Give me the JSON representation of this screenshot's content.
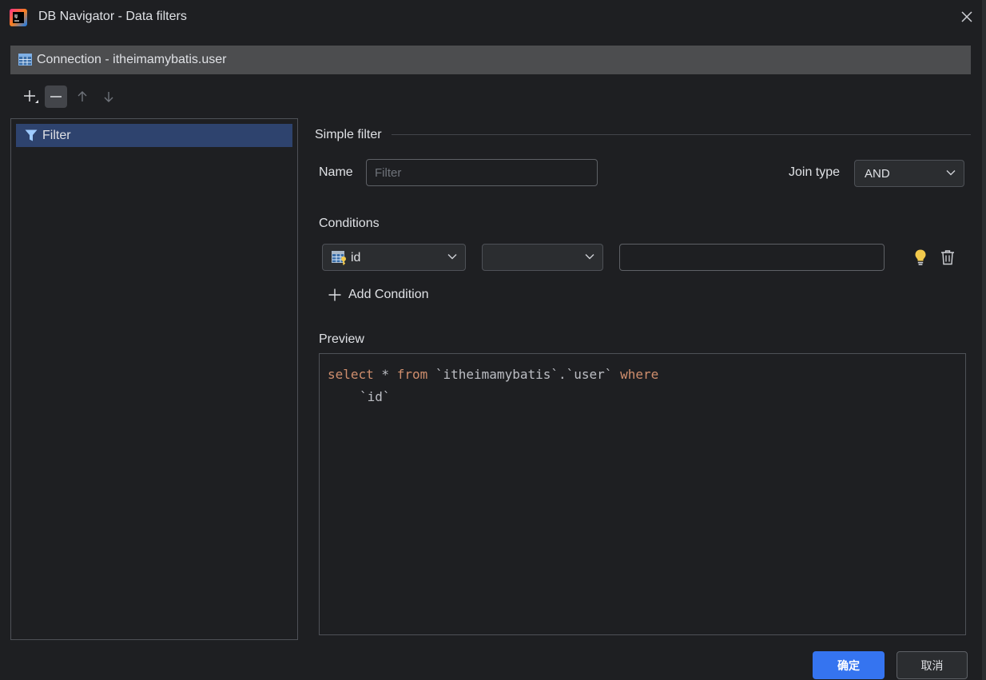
{
  "window": {
    "title": "DB Navigator - Data filters",
    "app_icon": "intellij-logo-icon",
    "close_icon": "close-icon"
  },
  "connection": {
    "label": "Connection - itheimamybatis.user",
    "icon": "table-icon"
  },
  "toolbar": {
    "add_icon": "plus-icon",
    "remove_icon": "minus-icon",
    "move_up_icon": "arrow-up-icon",
    "move_down_icon": "arrow-down-icon"
  },
  "filters": {
    "items": [
      {
        "label": "Filter",
        "icon": "funnel-icon",
        "selected": true
      }
    ]
  },
  "simple_filter": {
    "title": "Simple filter",
    "name_label": "Name",
    "name_value": "",
    "name_placeholder": "Filter",
    "join_type_label": "Join type",
    "join_type_value": "AND",
    "conditions_label": "Conditions",
    "condition": {
      "column": "id",
      "column_icon": "table-column-key-icon",
      "operator": "",
      "value": ""
    },
    "add_condition_label": "Add Condition",
    "preview_label": "Preview",
    "preview": {
      "kw_select": "select",
      "star": " * ",
      "kw_from": "from",
      "table": " `itheimamybatis`.`user` ",
      "kw_where": "where",
      "column": "`id`"
    }
  },
  "buttons": {
    "ok": "确定",
    "cancel": "取消"
  },
  "colors": {
    "accent": "#3574f0",
    "selection": "#2e436e",
    "keyword": "#cf8e6d",
    "background": "#1e1f22"
  }
}
